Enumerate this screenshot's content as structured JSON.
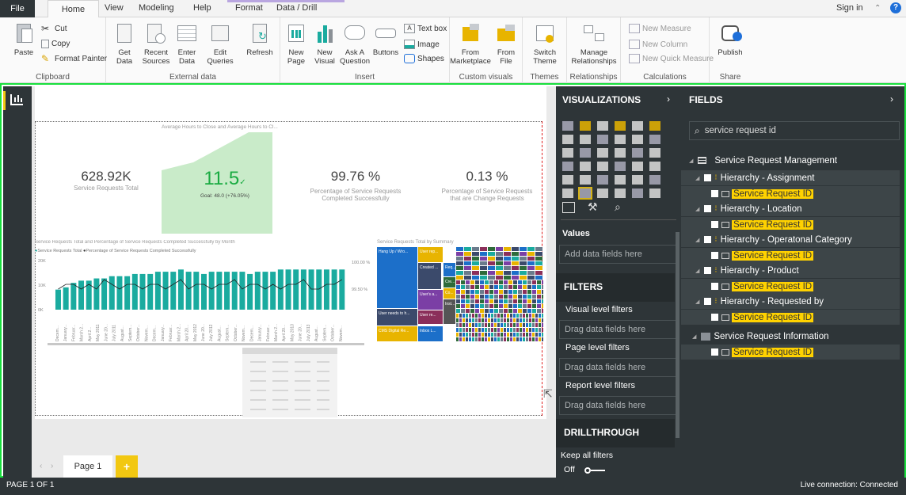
{
  "tabs": {
    "file": "File",
    "home": "Home",
    "view": "View",
    "modeling": "Modeling",
    "help": "Help",
    "format": "Format",
    "data_drill": "Data / Drill",
    "sign_in": "Sign in"
  },
  "ribbon": {
    "clipboard": {
      "paste": "Paste",
      "cut": "Cut",
      "copy": "Copy",
      "format_painter": "Format Painter",
      "label": "Clipboard"
    },
    "external": {
      "get_data": "Get Data",
      "recent_sources": "Recent Sources",
      "enter_data": "Enter Data",
      "edit_queries": "Edit Queries",
      "refresh": "Refresh",
      "label": "External data"
    },
    "insert": {
      "new_page": "New Page",
      "new_visual": "New Visual",
      "ask_question": "Ask A Question",
      "buttons": "Buttons",
      "text_box": "Text box",
      "image": "Image",
      "shapes": "Shapes",
      "label": "Insert"
    },
    "custom": {
      "from_marketplace": "From Marketplace",
      "from_file": "From File",
      "label": "Custom visuals"
    },
    "themes": {
      "switch_theme": "Switch Theme",
      "label": "Themes"
    },
    "relationships": {
      "manage": "Manage Relationships",
      "label": "Relationships"
    },
    "calculations": {
      "new_measure": "New Measure",
      "new_column": "New Column",
      "new_quick_measure": "New Quick Measure",
      "label": "Calculations"
    },
    "share": {
      "publish": "Publish",
      "label": "Share"
    }
  },
  "report": {
    "gauge_title": "Average Hours to Close and Average Hours to Cl...",
    "kpi1": {
      "value": "628.92K",
      "label": "Service Requests Total"
    },
    "kpi2": {
      "value": "11.5",
      "goal": "Goal: 48.0 (+76.05%)"
    },
    "kpi3": {
      "value": "99.76 %",
      "label": "Percentage of Service Requests Completed Successfully"
    },
    "kpi4": {
      "value": "0.13 %",
      "label": "Percentage of Service Requests that are Change Requests"
    },
    "combo_title": "Service Requests Total and Percentage of Service Requests Completed Successfully by Month",
    "combo_legend1": "Service Requests Total",
    "combo_legend2": "Percentage of Service Requests Completed Successfully",
    "treemap_title": "Service Requests Total by Summary",
    "treemap_labels": [
      "Hang Up / Wro...",
      "User rep...",
      "Created ...",
      "Req...",
      "Cre...",
      "User's a...",
      "Co...",
      "User needs to h...",
      "User re...",
      "CMS Digital Re...",
      "Inbox L...",
      "Inst..."
    ]
  },
  "chart_data": {
    "type": "bar",
    "title": "Service Requests Total and Percentage of Service Requests Completed Successfully by Month",
    "series": [
      {
        "name": "Service Requests Total",
        "values": [
          9,
          10,
          12,
          13,
          13,
          14,
          14,
          15,
          15,
          15,
          16,
          16,
          16,
          17,
          17,
          17,
          18,
          17,
          17,
          16,
          17,
          17,
          17,
          17,
          17,
          16,
          17,
          17,
          17,
          18,
          18,
          18,
          18,
          18,
          18,
          18,
          18,
          18
        ]
      },
      {
        "name": "Percentage of Service Requests Completed Successfully",
        "values": [
          99.7,
          99.8,
          99.8,
          99.7,
          99.8,
          99.7,
          99.9,
          99.8,
          99.7,
          99.8,
          99.8,
          99.7,
          99.8,
          99.8,
          99.7,
          99.8,
          99.9,
          99.7,
          99.8,
          99.8,
          99.7,
          99.8,
          99.8,
          99.9,
          99.7,
          99.8,
          99.8,
          99.7,
          99.8,
          99.7,
          99.8,
          99.8,
          99.9,
          99.7,
          99.7,
          99.8,
          99.8,
          99.9
        ]
      }
    ],
    "y_ticks": [
      "20K",
      "10K",
      "0K"
    ],
    "y2_ticks": [
      "100.00 %",
      "99.50 %"
    ],
    "x_labels": [
      "Decem...",
      "January...",
      "Februar...",
      "March 2...",
      "April 2...",
      "May 2011",
      "June 20...",
      "July 2011",
      "August...",
      "Septem...",
      "October...",
      "Novem...",
      "Decem...",
      "January...",
      "Februar...",
      "March 2...",
      "April 20...",
      "May 2012",
      "June 20...",
      "July 2012",
      "August...",
      "Septem...",
      "October...",
      "Novem...",
      "Decem...",
      "January...",
      "Februar...",
      "March 2...",
      "April 20...",
      "May 2013",
      "June 20...",
      "July 2013",
      "August...",
      "Septem...",
      "October...",
      "Novem..."
    ]
  },
  "page_tab": {
    "name": "Page 1",
    "add": "+"
  },
  "viz_pane": {
    "title": "VISUALIZATIONS",
    "values": "Values",
    "add_fields": "Add data fields here",
    "filters": "FILTERS",
    "visual_filters": "Visual level filters",
    "drag_here": "Drag data fields here",
    "page_filters": "Page level filters",
    "report_filters": "Report level filters",
    "drillthrough": "DRILLTHROUGH",
    "keep_filters": "Keep all filters",
    "off": "Off"
  },
  "fields_pane": {
    "title": "FIELDS",
    "search_value": "service request id",
    "table": "Service Request Management",
    "hierarchies": [
      "Hierarchy - Assignment",
      "Hierarchy - Location",
      "Hierarchy - Operatonal Category",
      "Hierarchy - Product",
      "Hierarchy - Requested by"
    ],
    "info_table": "Service Request Information",
    "field": "Service Request ID"
  },
  "status": {
    "page": "PAGE 1 OF 1",
    "connection": "Live connection: Connected"
  },
  "colors": {
    "accent_teal": "#1aab9f",
    "highlight": "#ffd200",
    "dark_pane": "#2e3538",
    "border_green": "#19e03d"
  }
}
